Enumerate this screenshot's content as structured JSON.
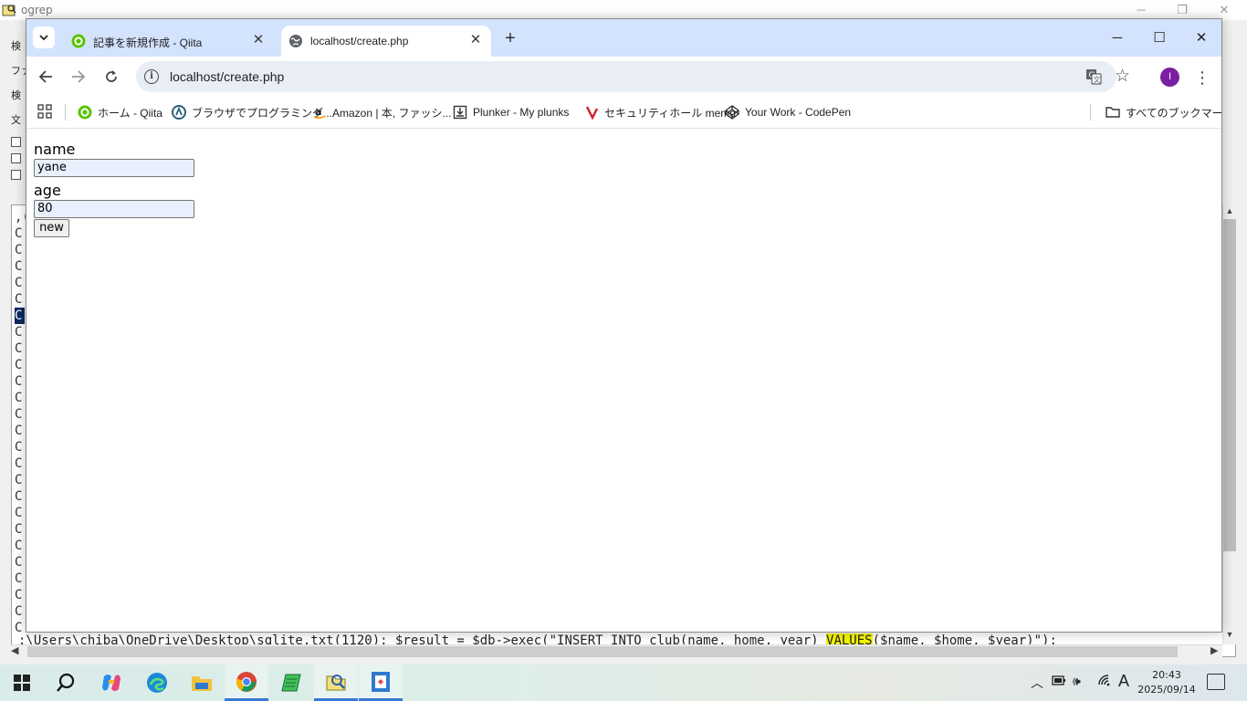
{
  "background_app": {
    "title": "ogrep",
    "side_labels": [
      "検",
      "ファ",
      "検",
      "文"
    ],
    "row_prefix": "C",
    "top_row_text": ",(",
    "bottom_line_before": ":\\Users\\chiba\\OneDrive\\Desktop\\sqlite.txt(1120):   $result = $db->exec(\"INSERT INTO club(name, home, year) ",
    "bottom_line_highlight": "VALUES",
    "bottom_line_after": "($name, $home, $year)\");"
  },
  "browser": {
    "tabs": [
      {
        "title": "記事を新規作成 - Qiita",
        "active": false
      },
      {
        "title": "localhost/create.php",
        "active": true
      }
    ],
    "new_tab_label": "+",
    "address": "localhost/create.php",
    "profile_initial": "I",
    "bookmarks": [
      {
        "label": "ホーム - Qiita",
        "icon": "qiita-icon"
      },
      {
        "label": "ブラウザでプログラミング...",
        "icon": "paiza-icon"
      },
      {
        "label": "Amazon | 本, ファッシ...",
        "icon": "amazon-icon"
      },
      {
        "label": "Plunker - My plunks",
        "icon": "plunker-icon"
      },
      {
        "label": "セキュリティホール memo",
        "icon": "security-icon"
      },
      {
        "label": "Your Work - CodePen",
        "icon": "codepen-icon"
      }
    ],
    "all_bookmarks_label": "すべてのブックマーク"
  },
  "page": {
    "name_label": "name",
    "name_value": "yane",
    "age_label": "age",
    "age_value": "80",
    "submit_label": "new"
  },
  "taskbar": {
    "apps": [
      "start",
      "search",
      "copilot",
      "edge",
      "file-explorer",
      "chrome",
      "notepad",
      "ogrep",
      "app"
    ],
    "ime_label": "A",
    "time": "20:43",
    "date": "2025/09/14"
  },
  "colors": {
    "tabstrip": "#d3e3fd",
    "omnibox": "#e9eef6",
    "input_fill": "#e8f0fe",
    "profile": "#7b1fa2",
    "highlight": "#f7f700"
  }
}
